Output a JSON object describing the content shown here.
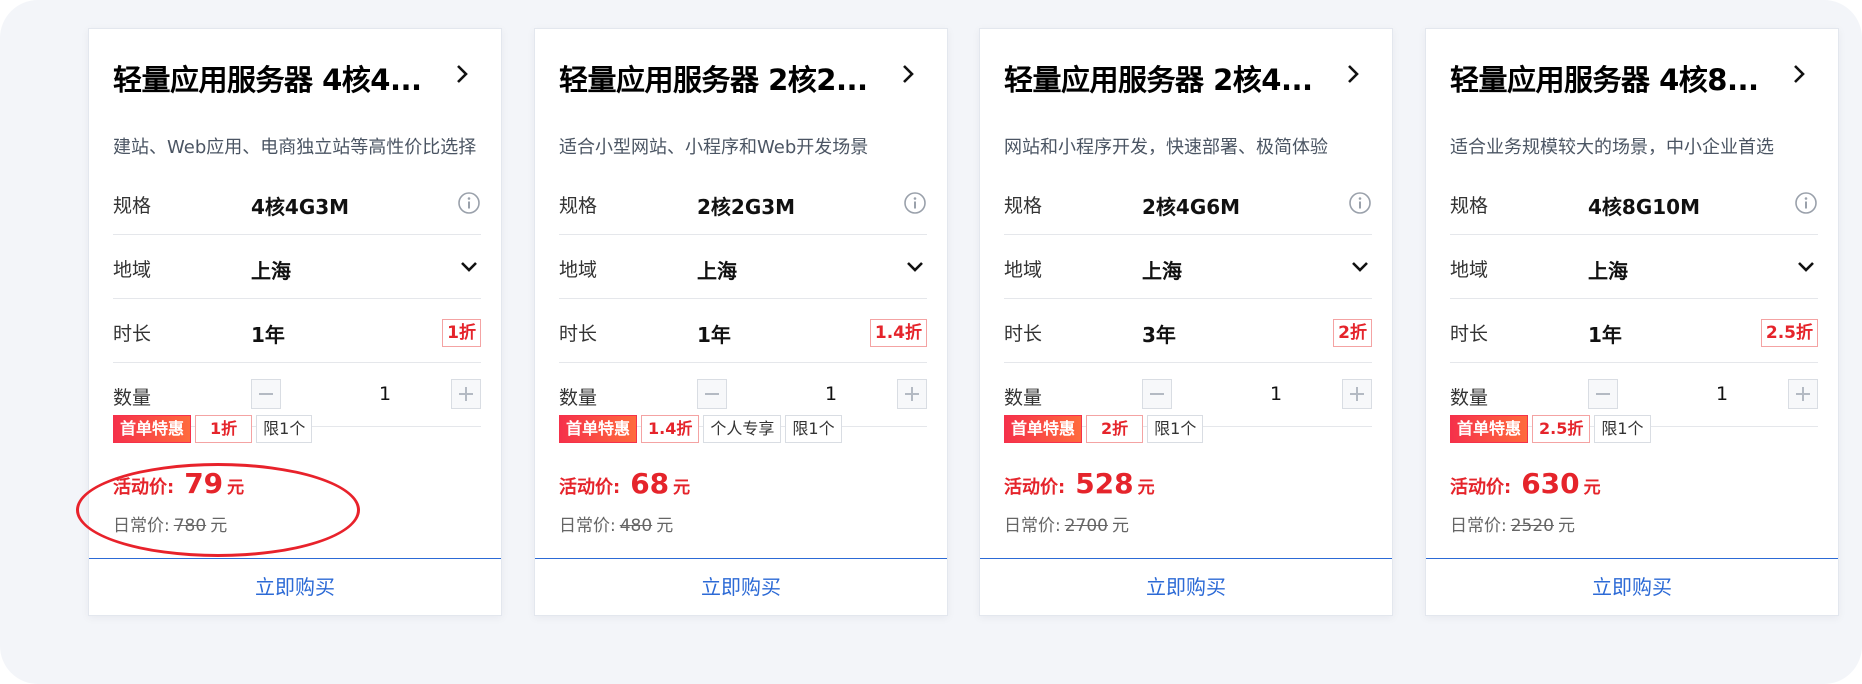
{
  "labels": {
    "spec": "规格",
    "region": "地域",
    "duration": "时长",
    "quantity": "数量",
    "first_order": "首单特惠",
    "limit": "限1个",
    "exclusive": "个人专享",
    "promo_price": "活动价:",
    "regular_price": "日常价:",
    "unit": "元",
    "buy": "立即购买"
  },
  "colors": {
    "accent_red": "#e5242b",
    "link_blue": "#2c6ad6",
    "highlight_circle": "#e8222b"
  },
  "cards": [
    {
      "title": "轻量应用服务器 4核4...",
      "desc": "建站、Web应用、电商独立站等高性价比选择",
      "spec": "4核4G3M",
      "region": "上海",
      "duration": "1年",
      "discount": "1折",
      "quantity": "1",
      "price": "79",
      "original": "780"
    },
    {
      "title": "轻量应用服务器 2核2...",
      "desc": "适合小型网站、小程序和Web开发场景",
      "spec": "2核2G3M",
      "region": "上海",
      "duration": "1年",
      "discount": "1.4折",
      "quantity": "1",
      "price": "68",
      "original": "480"
    },
    {
      "title": "轻量应用服务器 2核4...",
      "desc": "网站和小程序开发，快速部署、极简体验",
      "spec": "2核4G6M",
      "region": "上海",
      "duration": "3年",
      "discount": "2折",
      "quantity": "1",
      "price": "528",
      "original": "2700"
    },
    {
      "title": "轻量应用服务器 4核8...",
      "desc": "适合业务规模较大的场景，中小企业首选",
      "spec": "4核8G10M",
      "region": "上海",
      "duration": "1年",
      "discount": "2.5折",
      "quantity": "1",
      "price": "630",
      "original": "2520"
    }
  ]
}
